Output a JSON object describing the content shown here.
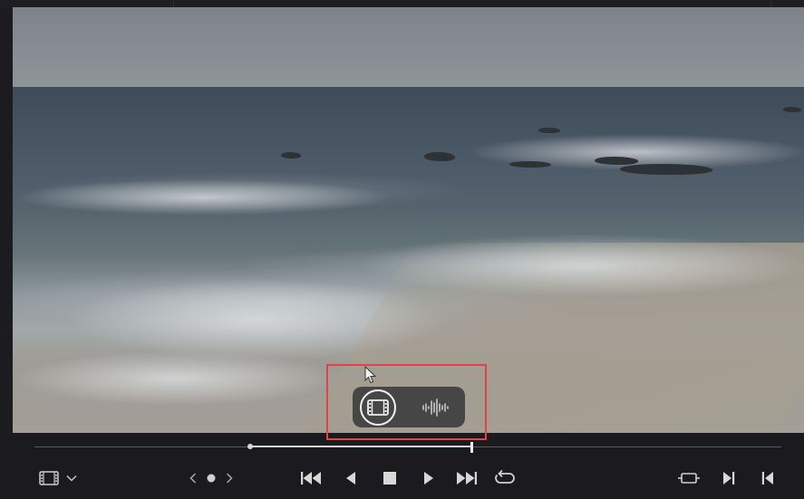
{
  "window": {
    "title": ""
  },
  "viewer": {
    "content": "beach-video-frame",
    "view_toggle": {
      "options": [
        {
          "id": "video",
          "icon": "film-strip-icon",
          "selected": true
        },
        {
          "id": "audio",
          "icon": "waveform-icon",
          "selected": false
        }
      ]
    },
    "annotation_color": "#e04545"
  },
  "timeline": {
    "range_start_fraction": 0.289,
    "playhead_fraction": 0.585
  },
  "transport": {
    "left": [
      {
        "icon": "film-strip-icon"
      },
      {
        "icon": "chevron-down-icon"
      }
    ],
    "markers": [
      {
        "icon": "chevron-left-icon"
      },
      {
        "icon": "dot-icon"
      },
      {
        "icon": "chevron-right-icon"
      }
    ],
    "playback": [
      {
        "icon": "skip-back-icon"
      },
      {
        "icon": "step-back-icon"
      },
      {
        "icon": "stop-icon"
      },
      {
        "icon": "play-icon"
      },
      {
        "icon": "skip-forward-icon"
      },
      {
        "icon": "loop-icon"
      }
    ],
    "right": [
      {
        "icon": "match-frame-icon"
      },
      {
        "icon": "out-point-icon"
      },
      {
        "icon": "in-point-icon"
      }
    ]
  },
  "colors": {
    "background": "#1b1b1f",
    "icon": "#d8d8d8",
    "highlight": "#e04545"
  }
}
